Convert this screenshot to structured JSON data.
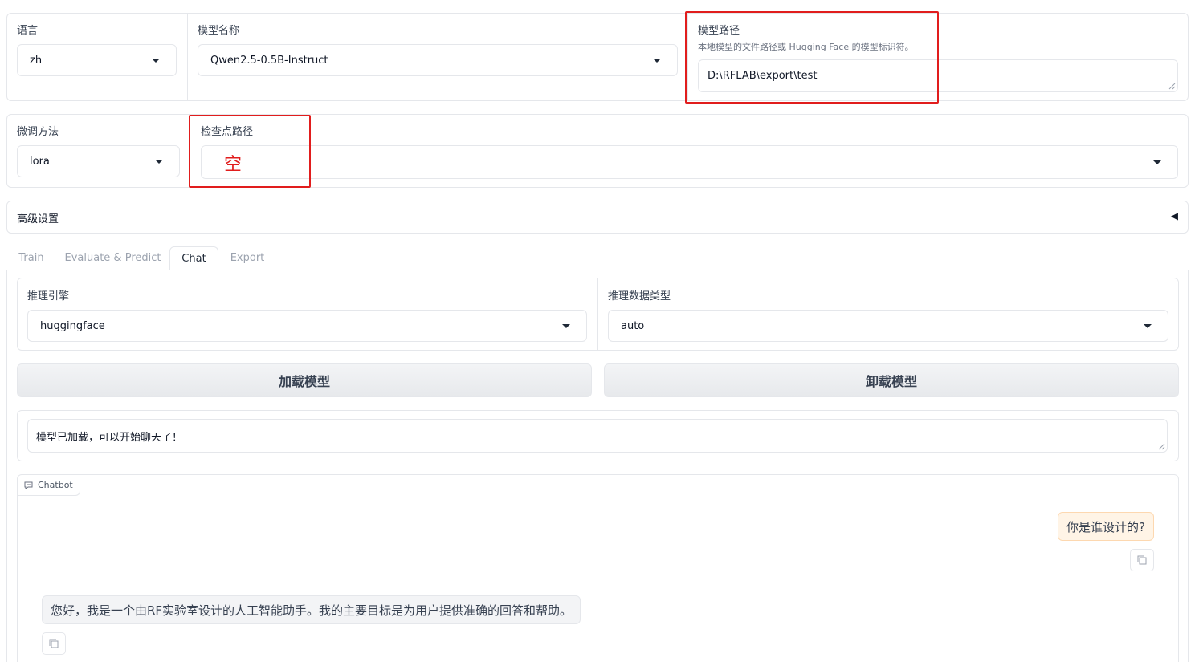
{
  "top_row": {
    "language": {
      "label": "语言",
      "value": "zh"
    },
    "model_name": {
      "label": "模型名称",
      "value": "Qwen2.5-0.5B-Instruct"
    },
    "model_path": {
      "label": "模型路径",
      "hint": "本地模型的文件路径或 Hugging Face 的模型标识符。",
      "value": "D:\\RFLAB\\export\\test"
    }
  },
  "second_row": {
    "finetune": {
      "label": "微调方法",
      "value": "lora"
    },
    "checkpoint": {
      "label": "检查点路径",
      "value": "",
      "annotation": "空"
    }
  },
  "advanced": {
    "label": "高级设置",
    "toggle": "◀"
  },
  "tabs": [
    {
      "label": "Train",
      "active": false
    },
    {
      "label": "Evaluate & Predict",
      "active": false
    },
    {
      "label": "Chat",
      "active": true
    },
    {
      "label": "Export",
      "active": false
    }
  ],
  "chat_panel": {
    "infer_backend": {
      "label": "推理引擎",
      "value": "huggingface"
    },
    "infer_dtype": {
      "label": "推理数据类型",
      "value": "auto"
    },
    "load_button": "加载模型",
    "unload_button": "卸载模型",
    "info_text": "模型已加载，可以开始聊天了！",
    "chatbot_label": "Chatbot",
    "messages": [
      {
        "role": "user",
        "text": "你是谁设计的?"
      },
      {
        "role": "assistant",
        "text": "您好，我是一个由RF实验室设计的人工智能助手。我的主要目标是为用户提供准确的回答和帮助。"
      }
    ]
  },
  "colors": {
    "annotation_red": "#e11d1d",
    "user_bubble_bg": "#fff4e6",
    "user_bubble_border": "#fdd8b0",
    "bot_bubble_bg": "#f3f4f6"
  }
}
